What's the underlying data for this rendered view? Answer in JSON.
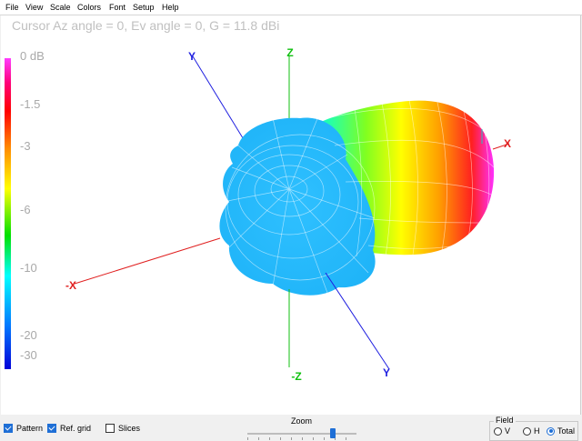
{
  "menu": [
    "File",
    "View",
    "Scale",
    "Colors",
    "Font",
    "Setup",
    "Help"
  ],
  "cursor_readout": "Cursor Az angle = 0,  Ev angle = 0,  G = 11.8 dBi",
  "color_scale": {
    "labels": [
      "0 dB",
      "-1.5",
      "-3",
      "-6",
      "-10",
      "-20",
      "-30"
    ],
    "gradient": [
      "#ff3cff",
      "#ff0000",
      "#ff8c00",
      "#ffff00",
      "#00e000",
      "#00ffff",
      "#0078ff",
      "#0000d8"
    ]
  },
  "axes": {
    "z_pos": "Z",
    "z_neg": "-Z",
    "x_pos": "X",
    "x_neg": "-X",
    "y_pos": "Y",
    "y_neg": "Y"
  },
  "axis_colors": {
    "x": "#e02020",
    "y": "#2020e0",
    "z": "#10c010"
  },
  "controls": {
    "pattern": {
      "label": "Pattern",
      "checked": true
    },
    "ref_grid": {
      "label": "Ref. grid",
      "checked": true
    },
    "slices": {
      "label": "Slices",
      "checked": false
    }
  },
  "zoom": {
    "label": "Zoom",
    "value": 0.78
  },
  "field": {
    "legend": "Field",
    "options": [
      {
        "label": "V",
        "selected": false
      },
      {
        "label": "H",
        "selected": false
      },
      {
        "label": "Total",
        "selected": true
      }
    ]
  }
}
